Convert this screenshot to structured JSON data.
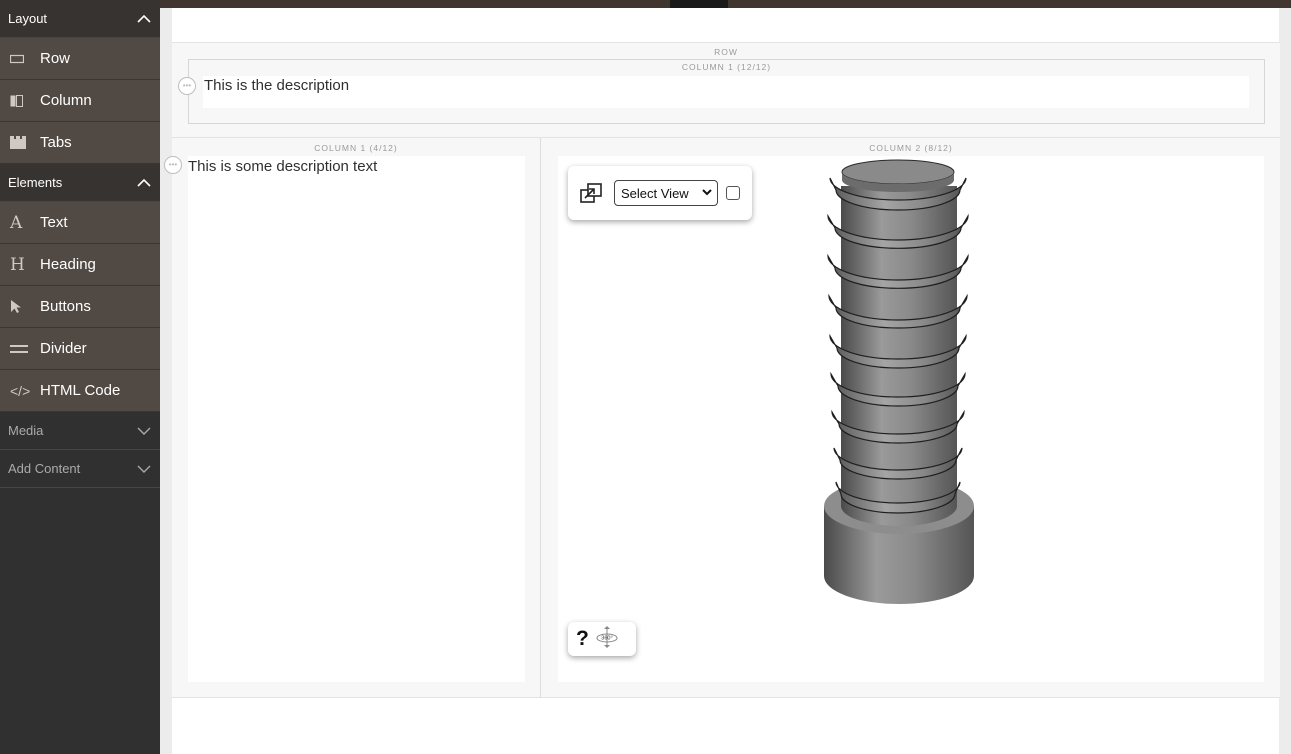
{
  "sidebar": {
    "sections": [
      {
        "title": "Layout",
        "expanded": true,
        "items": [
          {
            "label": "Row",
            "icon": "row-icon"
          },
          {
            "label": "Column",
            "icon": "column-icon"
          },
          {
            "label": "Tabs",
            "icon": "tabs-icon"
          }
        ]
      },
      {
        "title": "Elements",
        "expanded": true,
        "items": [
          {
            "label": "Text",
            "icon": "text-icon",
            "glyph": "A"
          },
          {
            "label": "Heading",
            "icon": "heading-icon",
            "glyph": "H"
          },
          {
            "label": "Buttons",
            "icon": "cursor-icon"
          },
          {
            "label": "Divider",
            "icon": "divider-icon"
          },
          {
            "label": "HTML Code",
            "icon": "code-icon",
            "glyph": "</>"
          }
        ]
      },
      {
        "title": "Media",
        "expanded": false
      },
      {
        "title": "Add Content",
        "expanded": false
      }
    ]
  },
  "stage": {
    "top_row": {
      "label": "ROW",
      "column_label": "COLUMN 1 (12/12)",
      "text": "This is the description"
    },
    "bottom_row": {
      "column1_label": "COLUMN 1 (4/12)",
      "column1_text": "This is some description text",
      "column2_label": "COLUMN 2 (8/12)",
      "viewer": {
        "select_value": "Select View",
        "checkbox_checked": false,
        "help_glyph": "?"
      }
    }
  },
  "colors": {
    "sidebar_bg": "#303030",
    "sidebar_item_bg": "#514943",
    "sidebar_header_bg": "#373330",
    "stage_bg": "#f7f7f7",
    "model_gray": "#7a7a7a"
  }
}
